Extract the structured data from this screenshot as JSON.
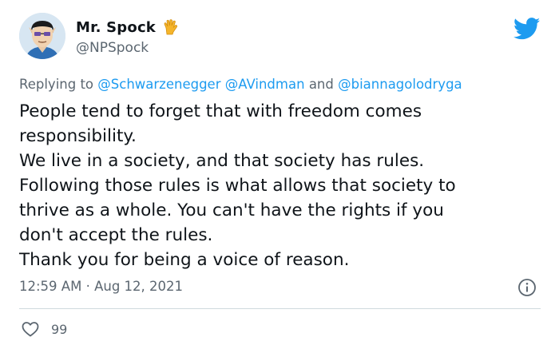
{
  "author": {
    "display_name": "Mr. Spock",
    "badge_icon": "vulcan-salute-icon",
    "handle": "@NPSpock",
    "avatar_icon": "spock-avatar-icon"
  },
  "brand": {
    "icon": "twitter-bird-icon",
    "color": "#1d9bf0"
  },
  "reply": {
    "prefix": "Replying to",
    "mentions": [
      "@Schwarzenegger",
      "@AVindman",
      "@biannagolodryga"
    ],
    "conjunction": "and"
  },
  "body_lines": [
    "People tend to forget that with freedom comes",
    "responsibility.",
    "We live in a society, and that society has rules.",
    "Following those rules is what allows that society to",
    "thrive as a whole. You can't have the rights if you",
    "don't accept the rules.",
    "Thank you for being a voice of reason."
  ],
  "meta": {
    "time": "12:59 AM",
    "separator": "·",
    "date": "Aug 12, 2021",
    "info_icon": "info-icon"
  },
  "engagement": {
    "like_icon": "heart-icon",
    "like_count": "99"
  }
}
